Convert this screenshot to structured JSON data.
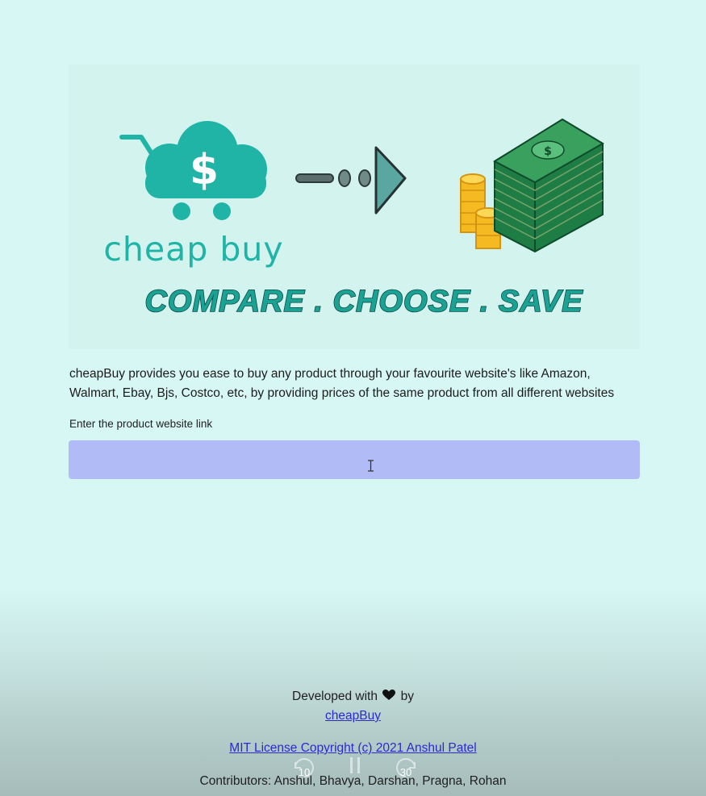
{
  "hero": {
    "brand_name": "cheap buy",
    "tagline": "COMPARE . CHOOSE . SAVE",
    "currency_symbol": "$",
    "colors": {
      "teal": "#1fb4a6",
      "dark_teal": "#0b4b45",
      "money_green": "#2e7d4f",
      "coin_gold": "#f7c531",
      "background": "#d3f3ef"
    }
  },
  "description": "cheapBuy provides you ease to buy any product through your favourite website's like Amazon, Walmart, Ebay, Bjs, Costco, etc, by providing prices of the same product from all different websites",
  "input": {
    "label": "Enter the product website link",
    "value": "",
    "placeholder": "",
    "background": "#b1bcf6"
  },
  "footer": {
    "developed_prefix": "Developed with",
    "developed_suffix": "by",
    "brand_link": "cheapBuy",
    "license_link": "MIT License Copyright (c) 2021 Anshul Patel",
    "contributors": "Contributors: Anshul, Bhavya, Darshan, Pragna, Rohan"
  },
  "player_overlay": {
    "rewind_seconds": "10",
    "forward_seconds": "30"
  }
}
